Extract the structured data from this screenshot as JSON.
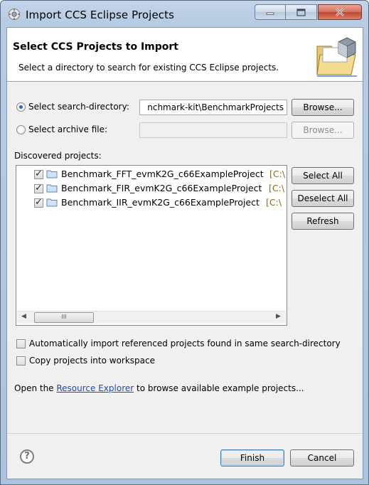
{
  "window": {
    "title": "Import CCS Eclipse Projects"
  },
  "header": {
    "title": "Select CCS Projects to Import",
    "subtitle": "Select a directory to search for existing CCS Eclipse projects."
  },
  "source": {
    "search_dir_label": "Select search-directory:",
    "search_dir_value": "nchmark-kit\\BenchmarkProjects",
    "archive_label": "Select archive file:",
    "archive_value": "",
    "browse_label": "Browse...",
    "browse_archive_label": "Browse...",
    "selected": "search-directory"
  },
  "projects": {
    "label": "Discovered projects:",
    "items": [
      {
        "name": "Benchmark_FFT_evmK2G_c66ExampleProject",
        "path": "[C:\\",
        "checked": true
      },
      {
        "name": "Benchmark_FIR_evmK2G_c66ExampleProject",
        "path": "[C:\\",
        "checked": true
      },
      {
        "name": "Benchmark_IIR_evmK2G_c66ExampleProject",
        "path": "[C:\\",
        "checked": true
      }
    ],
    "select_all": "Select All",
    "deselect_all": "Deselect All",
    "refresh": "Refresh",
    "scroll_thumb_glyph": "III"
  },
  "options": {
    "auto_import": {
      "label": "Automatically import referenced projects found in same search-directory",
      "checked": false
    },
    "copy_into_workspace": {
      "label": "Copy projects into workspace",
      "checked": false
    }
  },
  "resource_line": {
    "prefix": "Open the ",
    "link": "Resource Explorer",
    "suffix": " to browse available example projects..."
  },
  "footer": {
    "help_glyph": "?",
    "finish": "Finish",
    "cancel": "Cancel"
  }
}
